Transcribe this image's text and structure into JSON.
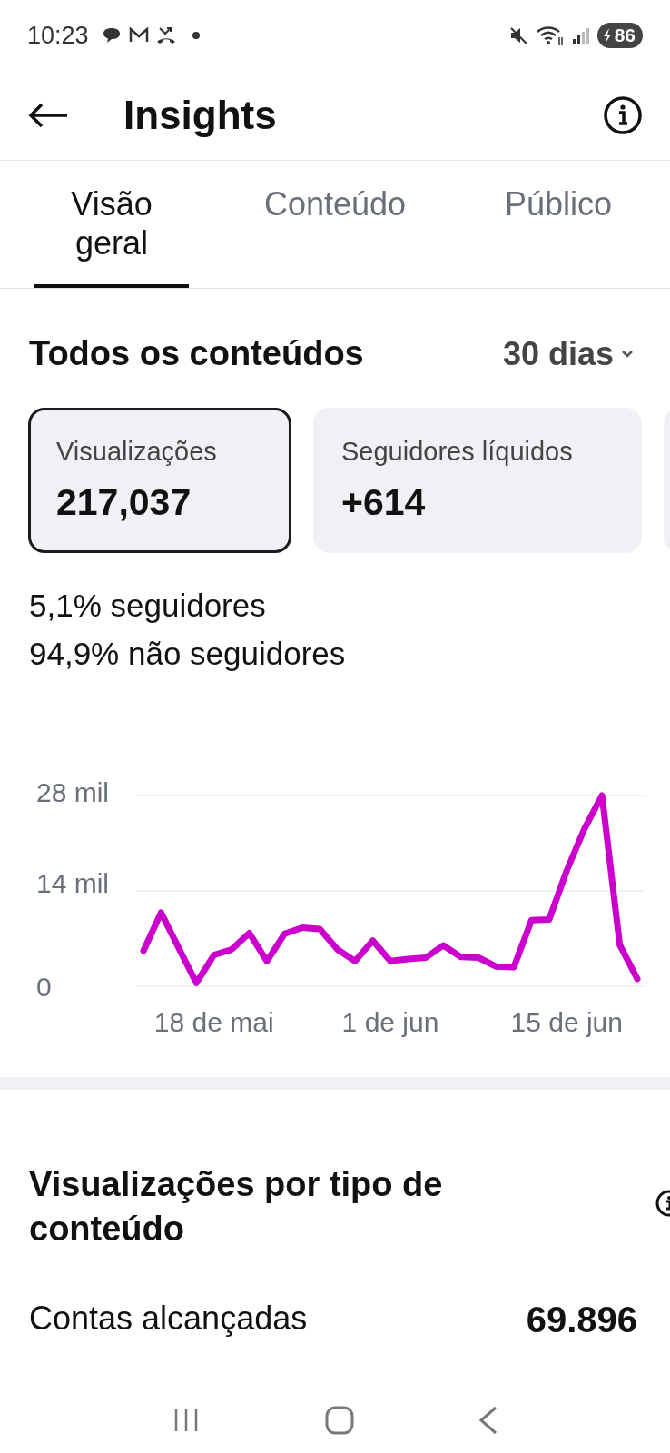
{
  "status_bar": {
    "time": "10:23",
    "battery": "86"
  },
  "header": {
    "title": "Insights"
  },
  "tabs": [
    {
      "label": "Visão geral",
      "selected": true
    },
    {
      "label": "Conteúdo",
      "selected": false
    },
    {
      "label": "Público",
      "selected": false
    }
  ],
  "summary": {
    "title": "Todos os conteúdos",
    "period": "30 dias"
  },
  "metric_cards": [
    {
      "label": "Visualizações",
      "value": "217,037",
      "selected": true
    },
    {
      "label": "Seguidores líquidos",
      "value": "+614",
      "selected": false
    }
  ],
  "breakdown": [
    "5,1% seguidores",
    "94,9% não seguidores"
  ],
  "chart_data": {
    "type": "line",
    "categories": [
      null,
      null,
      null,
      null,
      "18 de mai",
      null,
      null,
      null,
      null,
      null,
      null,
      null,
      null,
      null,
      "1 de jun",
      null,
      null,
      null,
      null,
      null,
      null,
      null,
      null,
      null,
      "15 de jun",
      null,
      null,
      null,
      null
    ],
    "series": [
      {
        "color": "#cc00cc",
        "values": [
          5.2,
          10.8,
          5.6,
          0.5,
          4.6,
          5.4,
          7.8,
          3.7,
          7.7,
          8.6,
          8.4,
          5.4,
          3.7,
          6.7,
          3.7,
          4.0,
          4.2,
          6.0,
          4.3,
          4.2,
          2.9,
          2.8,
          9.7,
          9.8,
          17.0,
          23.1,
          28.0,
          6.1,
          1.1
        ]
      }
    ],
    "ylim": [
      0,
      28
    ],
    "yticks": [
      {
        "value": 0,
        "label": "0"
      },
      {
        "value": 14,
        "label": "14 mil"
      },
      {
        "value": 28,
        "label": "28 mil"
      }
    ]
  },
  "content_type": {
    "title": "Visualizações por tipo de conteúdo",
    "rows": [
      {
        "label": "Contas alcançadas",
        "value": "69.896"
      }
    ]
  }
}
